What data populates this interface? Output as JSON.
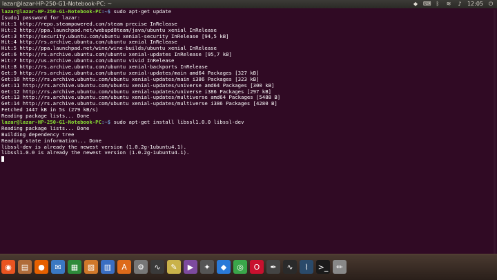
{
  "window": {
    "title": "lazar@lazar-HP-250-G1-Notebook-PC: ~"
  },
  "tray": {
    "clock": "12:05",
    "icons": [
      "dropbox-icon",
      "keyboard-icon",
      "bluetooth-icon",
      "wifi-icon",
      "volume-icon",
      "power-icon"
    ]
  },
  "terminal": {
    "prompt_user": "lazar@lazar-HP-250-G1-Notebook-PC",
    "lines": [
      {
        "prompt": "lazar@lazar-HP-250-G1-Notebook-PC",
        "dir": ":~$ ",
        "text": "sudo apt-get update"
      },
      {
        "text": "[sudo] password for lazar:"
      },
      {
        "text": "Hit:1 http://repo.steampowered.com/steam precise InRelease"
      },
      {
        "text": "Hit:2 http://ppa.launchpad.net/webupd8team/java/ubuntu xenial InRelease"
      },
      {
        "text": "Get:3 http://security.ubuntu.com/ubuntu xenial-security InRelease [94,5 kB]"
      },
      {
        "text": "Hit:4 http://rs.archive.ubuntu.com/ubuntu xenial InRelease"
      },
      {
        "text": "Hit:5 http://ppa.launchpad.net/wine/wine-builds/ubuntu xenial InRelease"
      },
      {
        "text": "Get:6 http://rs.archive.ubuntu.com/ubuntu xenial-updates InRelease [95,7 kB]"
      },
      {
        "text": "Hit:7 http://us.archive.ubuntu.com/ubuntu vivid InRelease"
      },
      {
        "text": "Hit:8 http://rs.archive.ubuntu.com/ubuntu xenial-backports InRelease"
      },
      {
        "text": "Get:9 http://rs.archive.ubuntu.com/ubuntu xenial-updates/main amd64 Packages [327 kB]"
      },
      {
        "text": "Get:10 http://rs.archive.ubuntu.com/ubuntu xenial-updates/main i386 Packages [323 kB]"
      },
      {
        "text": "Get:11 http://rs.archive.ubuntu.com/ubuntu xenial-updates/universe amd64 Packages [300 kB]"
      },
      {
        "text": "Get:12 http://rs.archive.ubuntu.com/ubuntu xenial-updates/universe i386 Packages [297 kB]"
      },
      {
        "text": "Get:13 http://rs.archive.ubuntu.com/ubuntu xenial-updates/multiverse amd64 Packages [5488 B]"
      },
      {
        "text": "Get:14 http://rs.archive.ubuntu.com/ubuntu xenial-updates/multiverse i386 Packages [4280 B]"
      },
      {
        "text": "Fetched 1447 kB in 5s (279 kB/s)"
      },
      {
        "text": "Reading package lists... Done"
      },
      {
        "prompt": "lazar@lazar-HP-250-G1-Notebook-PC",
        "dir": ":~$ ",
        "text": "sudo apt-get install libssl1.0.0 libssl-dev"
      },
      {
        "text": "Reading package lists... Done"
      },
      {
        "text": "Building dependency tree"
      },
      {
        "text": "Reading state information... Done"
      },
      {
        "text": "libssl-dev is already the newest version (1.0.2g-1ubuntu4.1)."
      },
      {
        "text": "libssl1.0.0 is already the newest version (1.0.2g-1ubuntu4.1)."
      }
    ]
  },
  "dock": {
    "items": [
      {
        "name": "ubuntu-dash-icon",
        "glyph": "◉",
        "color": "#e95420"
      },
      {
        "name": "files-icon",
        "glyph": "▤",
        "color": "#b06c3a"
      },
      {
        "name": "firefox-icon",
        "glyph": "●",
        "color": "#e66000"
      },
      {
        "name": "thunderbird-icon",
        "glyph": "✉",
        "color": "#3a78c2"
      },
      {
        "name": "libreoffice-calc-icon",
        "glyph": "▦",
        "color": "#2e8b3a"
      },
      {
        "name": "libreoffice-impress-icon",
        "glyph": "▧",
        "color": "#d0782a"
      },
      {
        "name": "libreoffice-writer-icon",
        "glyph": "▥",
        "color": "#3a6ec2"
      },
      {
        "name": "software-center-icon",
        "glyph": "A",
        "color": "#dd6a1a"
      },
      {
        "name": "settings-icon",
        "glyph": "⚙",
        "color": "#777777"
      },
      {
        "name": "system-monitor-icon",
        "glyph": "∿",
        "color": "#3a3a3a"
      },
      {
        "name": "text-editor-icon",
        "glyph": "✎",
        "color": "#c9b24a"
      },
      {
        "name": "media-player-icon",
        "glyph": "▶",
        "color": "#7d4a9e"
      },
      {
        "name": "game-icon",
        "glyph": "✦",
        "color": "#555555"
      },
      {
        "name": "dropbox-icon",
        "glyph": "◆",
        "color": "#2a7ad8"
      },
      {
        "name": "chrome-icon",
        "glyph": "◎",
        "color": "#3aa64a"
      },
      {
        "name": "opera-icon",
        "glyph": "O",
        "color": "#c8102e"
      },
      {
        "name": "pen-icon",
        "glyph": "✒",
        "color": "#444444"
      },
      {
        "name": "system-monitor-2-icon",
        "glyph": "∿",
        "color": "#2a2a2a"
      },
      {
        "name": "activity-monitor-icon",
        "glyph": "⌇",
        "color": "#2a4a6a"
      },
      {
        "name": "terminal-icon",
        "glyph": ">_",
        "color": "#1a1a1a"
      },
      {
        "name": "notes-icon",
        "glyph": "✏",
        "color": "#888888"
      }
    ]
  }
}
